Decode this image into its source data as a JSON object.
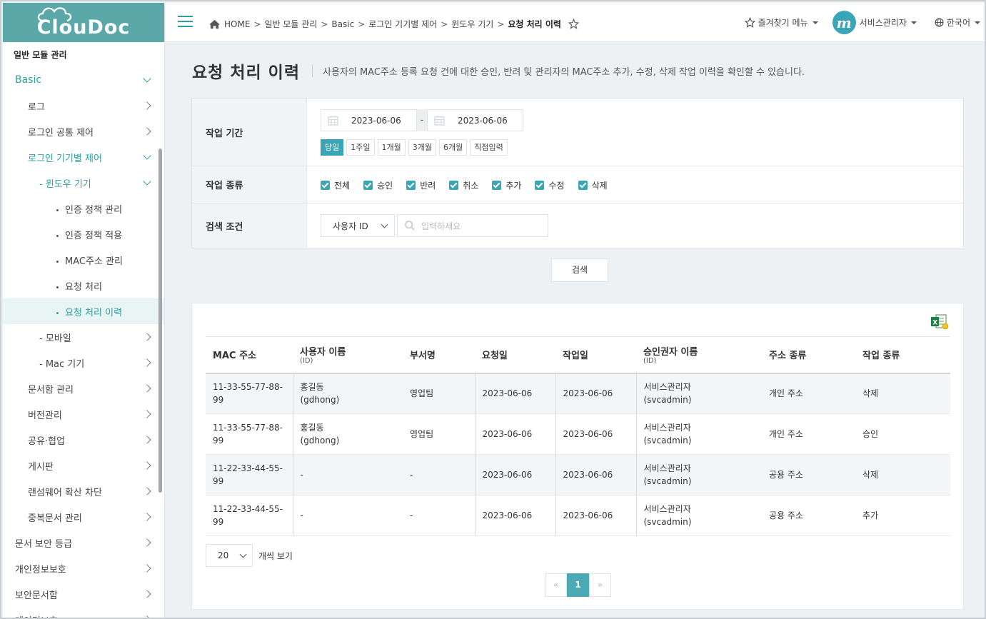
{
  "app": {
    "logo": "ClouDoc"
  },
  "header": {
    "breadcrumb": [
      "HOME",
      "일반 모듈 관리",
      "Basic",
      "로그인 기기별 제어",
      "윈도우 기기",
      "요청 처리 이력"
    ],
    "favorites_label": "즐겨찾기 메뉴",
    "user_name": "서비스관리자",
    "avatar_letter": "m",
    "language": "한국어"
  },
  "sidebar": {
    "items": [
      {
        "label": "일반 모듈 관리",
        "level": "section"
      },
      {
        "label": "Basic",
        "level": "lv0",
        "chev": "down",
        "teal": true
      },
      {
        "label": "로그",
        "level": "lv1",
        "chev": "right"
      },
      {
        "label": "로그인 공통 제어",
        "level": "lv1",
        "chev": "right"
      },
      {
        "label": "로그인 기기별 제어",
        "level": "lv1",
        "chev": "down",
        "teal": true
      },
      {
        "label": "- 윈도우 기기",
        "level": "lv2",
        "chev": "down",
        "teal": true
      },
      {
        "label": "인증 정책 관리",
        "level": "lv3",
        "bullet": true
      },
      {
        "label": "인증 정책 적용",
        "level": "lv3",
        "bullet": true
      },
      {
        "label": "MAC주소 관리",
        "level": "lv3",
        "bullet": true
      },
      {
        "label": "요청 처리",
        "level": "lv3",
        "bullet": true
      },
      {
        "label": "요청 처리 이력",
        "level": "lv3",
        "bullet": true,
        "active": true
      },
      {
        "label": "- 모바일",
        "level": "lv2",
        "chev": "right"
      },
      {
        "label": "- Mac 기기",
        "level": "lv2",
        "chev": "right"
      },
      {
        "label": "문서함 관리",
        "level": "lv1",
        "chev": "right"
      },
      {
        "label": "버전관리",
        "level": "lv1",
        "chev": "right"
      },
      {
        "label": "공유·협업",
        "level": "lv1",
        "chev": "right"
      },
      {
        "label": "게시판",
        "level": "lv1",
        "chev": "right"
      },
      {
        "label": "랜섬웨어 확산 차단",
        "level": "lv1",
        "chev": "right"
      },
      {
        "label": "중복문서 관리",
        "level": "lv1",
        "chev": "right"
      },
      {
        "label": "문서 보안 등급",
        "level": "lv0",
        "chev": "right"
      },
      {
        "label": "개인정보보호",
        "level": "lv0",
        "chev": "right"
      },
      {
        "label": "보안문서함",
        "level": "lv0",
        "chev": "right"
      },
      {
        "label": "데이터보호",
        "level": "lv0",
        "chev": "right"
      }
    ]
  },
  "page": {
    "title": "요청 처리 이력",
    "description": "사용자의 MAC주소 등록 요청 건에 대한 승인, 반려 및 관리자의 MAC주소 추가, 수정, 삭제 작업 이력을 확인할 수 있습니다."
  },
  "search": {
    "period_label": "작업 기간",
    "date_from": "2023-06-06",
    "date_to": "2023-06-06",
    "date_sep": "-",
    "period_buttons": [
      "당일",
      "1주일",
      "1개월",
      "3개월",
      "6개월",
      "직접입력"
    ],
    "period_selected": 0,
    "type_label": "작업 종류",
    "types": [
      "전체",
      "승인",
      "반려",
      "취소",
      "추가",
      "수정",
      "삭제"
    ],
    "cond_label": "검색 조건",
    "cond_select": "사용자 ID",
    "input_placeholder": "입력하세요",
    "button": "검색"
  },
  "table": {
    "columns": [
      {
        "label": "MAC 주소",
        "sub": ""
      },
      {
        "label": "사용자 이름",
        "sub": "(ID)"
      },
      {
        "label": "부서명",
        "sub": ""
      },
      {
        "label": "요청일",
        "sub": ""
      },
      {
        "label": "작업일",
        "sub": ""
      },
      {
        "label": "승인권자 이름",
        "sub": "(ID)"
      },
      {
        "label": "주소 종류",
        "sub": ""
      },
      {
        "label": "작업 종류",
        "sub": ""
      }
    ],
    "rows": [
      {
        "mac": "11-33-55-77-88-99",
        "user": "홍길동",
        "user_id": "(gdhong)",
        "dept": "영업팀",
        "req": "2023-06-06",
        "work": "2023-06-06",
        "approver": "서비스관리자",
        "approver_id": "(svcadmin)",
        "addr": "개인 주소",
        "type": "삭제"
      },
      {
        "mac": "11-33-55-77-88-99",
        "user": "홍길동",
        "user_id": "(gdhong)",
        "dept": "영업팀",
        "req": "2023-06-06",
        "work": "2023-06-06",
        "approver": "서비스관리자",
        "approver_id": "(svcadmin)",
        "addr": "개인 주소",
        "type": "승인"
      },
      {
        "mac": "11-22-33-44-55-99",
        "user": "-",
        "user_id": "",
        "dept": "-",
        "req": "2023-06-06",
        "work": "2023-06-06",
        "approver": "서비스관리자",
        "approver_id": "(svcadmin)",
        "addr": "공용 주소",
        "type": "삭제"
      },
      {
        "mac": "11-22-33-44-55-99",
        "user": "-",
        "user_id": "",
        "dept": "-",
        "req": "2023-06-06",
        "work": "2023-06-06",
        "approver": "서비스관리자",
        "approver_id": "(svcadmin)",
        "addr": "공용 주소",
        "type": "추가"
      }
    ]
  },
  "pagination": {
    "page_size": "20",
    "page_size_suffix": "개씩 보기",
    "prev": "«",
    "next": "»",
    "pages": [
      "1"
    ],
    "current": "1"
  },
  "colors": {
    "brand": "#5aa9a8",
    "accent": "#3aa5b7",
    "active_text": "#2e9f9d"
  }
}
